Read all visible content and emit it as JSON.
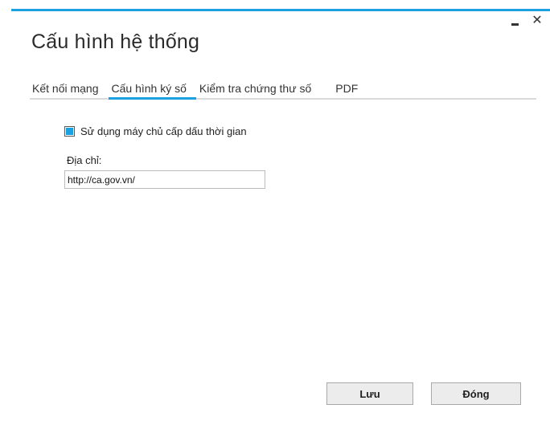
{
  "window": {
    "title": "Cấu hình hệ thống",
    "minimize_label": "-",
    "close_label": "✕",
    "accent_color": "#1ba1e2"
  },
  "tabs": [
    {
      "label": "Kết nối mạng",
      "active": false
    },
    {
      "label": "Cấu hình ký số",
      "active": true
    },
    {
      "label": "Kiểm tra chứng thư số",
      "active": false
    },
    {
      "label": "PDF",
      "active": false
    }
  ],
  "timestamp_server": {
    "checkbox_label": "Sử dụng máy chủ cấp dấu thời gian",
    "checked": true,
    "address_label": "Địa chỉ:",
    "address_value": "http://ca.gov.vn/"
  },
  "buttons": {
    "save_label": "Lưu",
    "close_label": "Đóng"
  }
}
